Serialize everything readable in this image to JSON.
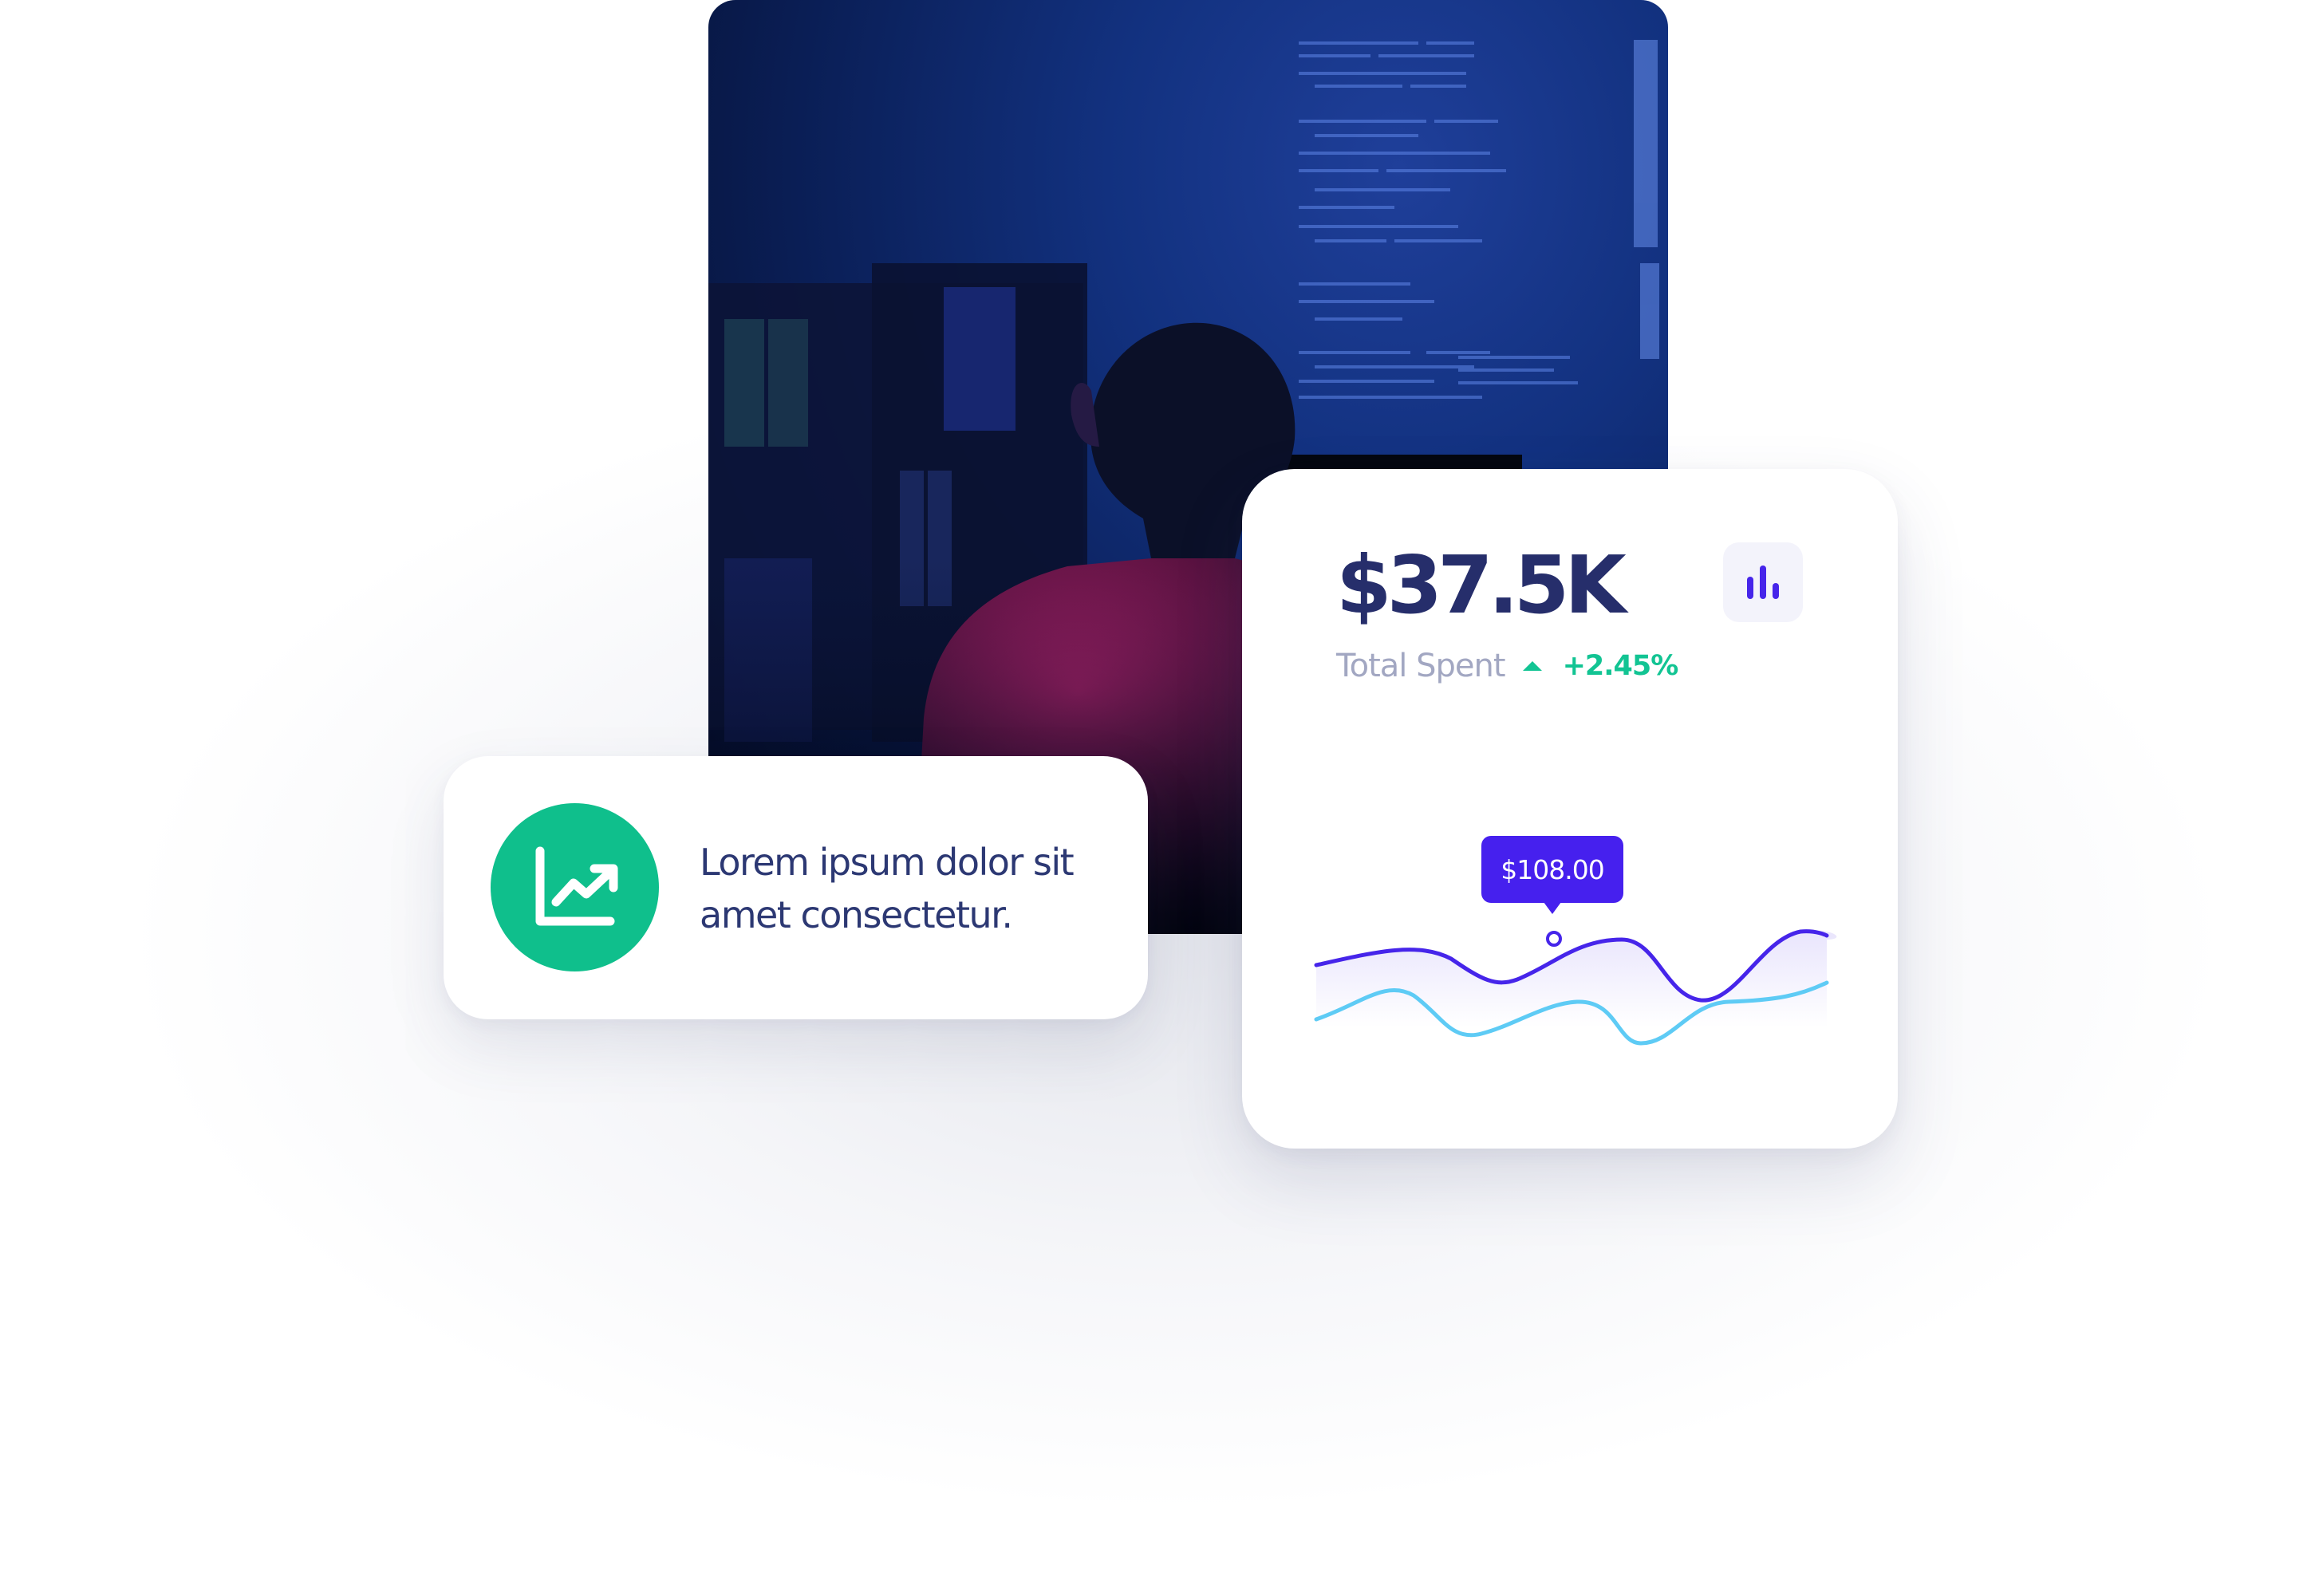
{
  "hero": {
    "image_icon": "developer-at-monitor-photo"
  },
  "stat_card": {
    "amount": "$37.5K",
    "label": "Total Spent",
    "change": "+2.45%",
    "change_icon": "triangle-up-icon",
    "chart_button_icon": "bar-chart-icon",
    "tooltip": "$108.00",
    "colors": {
      "amount": "#262e6b",
      "label": "#a2a7c2",
      "positive": "#12c493",
      "primary_line": "#4625ea",
      "secondary_line": "#5ecbf5"
    }
  },
  "info_card": {
    "icon": "line-chart-trending-up-icon",
    "text": "Lorem ipsum dolor sit amet consectetur.",
    "colors": {
      "badge": "#0fbf8c",
      "text": "#2c3873"
    }
  }
}
